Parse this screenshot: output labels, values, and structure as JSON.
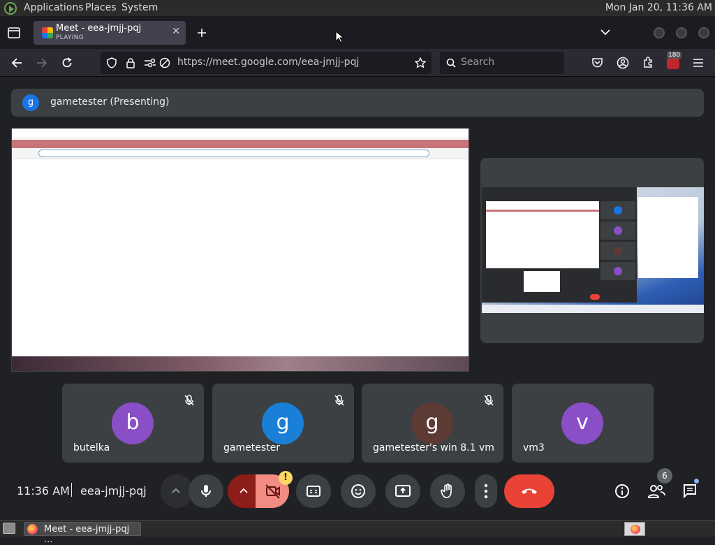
{
  "panel": {
    "menus": [
      "Applications",
      "Places",
      "System"
    ],
    "clock": "Mon Jan 20, 11:36 AM"
  },
  "browser": {
    "tab": {
      "title": "Meet - eea-jmjj-pqj",
      "status": "PLAYING"
    },
    "url": "https://meet.google.com/eea-jmjj-pqj",
    "search_placeholder": "Search",
    "extension_badge": "180"
  },
  "meet": {
    "presenter": {
      "initial": "g",
      "label": "gametester (Presenting)"
    },
    "participants": [
      {
        "name": "butelka",
        "initial": "b",
        "color": "#8a4fc7",
        "muted": true
      },
      {
        "name": "gametester",
        "initial": "g",
        "color": "#1a7fd6",
        "muted": true
      },
      {
        "name": "gametester's win 8.1 vm",
        "initial": "g",
        "color": "#5d3a34",
        "muted": true
      },
      {
        "name": "vm3",
        "initial": "v",
        "color": "#8a4fc7",
        "muted": false
      }
    ],
    "controls": {
      "time": "11:36 AM",
      "meeting_code": "eea-jmjj-pqj",
      "people_count": "6",
      "camera_warning": "!"
    },
    "colors": {
      "end_call": "#ea4335",
      "camera_off": "#f28b82",
      "accent": "#1a73e8"
    }
  },
  "taskbar": {
    "item": "Meet - eea-jmjj-pqj ..."
  }
}
